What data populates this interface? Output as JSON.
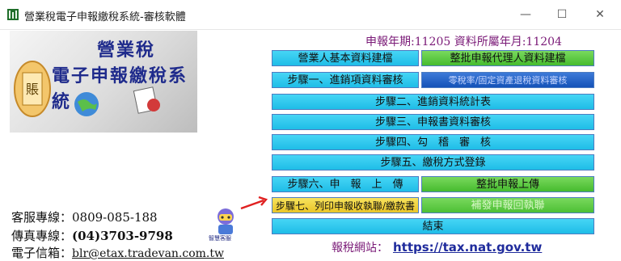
{
  "window": {
    "title": "營業稅電子申報繳稅系統-審核軟體",
    "minimize": "—",
    "maximize": "☐",
    "close": "✕"
  },
  "banner": {
    "line1": "營業稅",
    "line2": "電子申報繳稅系統"
  },
  "header": {
    "period_text": "申報年期:11205  資料所屬年月:11204"
  },
  "buttons": {
    "business_basic": "營業人基本資料建檔",
    "batch_agent": "整批申報代理人資料建檔",
    "step1": "步驟一、進銷項資料審核",
    "zero_tax": "零稅率/固定資產退稅資料審核",
    "step2": "步驟二、進銷資料統計表",
    "step3": "步驟三、申報書資料審核",
    "step4": "步驟四、勾　稽　審　核",
    "step5": "步驟五、繳稅方式登錄",
    "step6": "步驟六、申　報　上　傳",
    "batch_upload": "整批申報上傳",
    "step7": "步驟七、列印申報收執聯/繳款書",
    "batch_receipt": "補發申報回執聯",
    "end": "結束"
  },
  "contact": {
    "service": "客服專線：0809-085-188",
    "fax_label": "傳真專線：",
    "fax": "(04)3703-9798",
    "email_label": "電子信箱：",
    "email": "blr@etax.tradevan.com.tw"
  },
  "robot_label": "智慧客服",
  "footer": {
    "site_label": "報稅網站：",
    "site_url": "https://tax.nat.gov.tw"
  },
  "colors": {
    "accent_purple": "#7a1a77",
    "banner_blue": "#1f2b8c",
    "button_cyan": "#1fbde7",
    "button_green": "#46bb2e",
    "arrow_red": "#e02020"
  }
}
